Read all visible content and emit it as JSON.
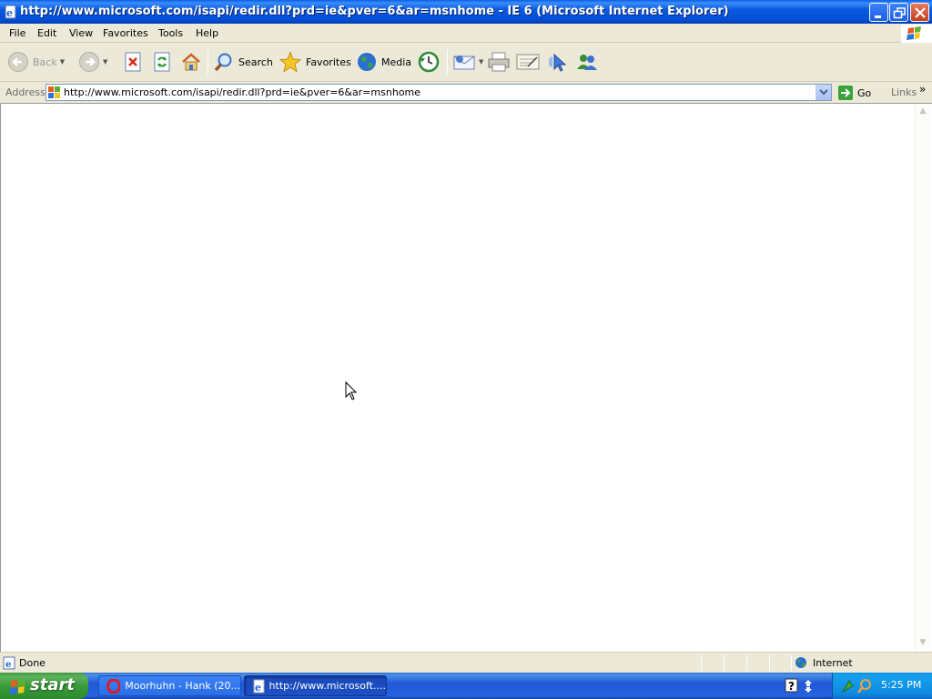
{
  "window": {
    "title": "http://www.microsoft.com/isapi/redir.dll?prd=ie&pver=6&ar=msnhome - IE 6 (Microsoft Internet Explorer)"
  },
  "menu": [
    "File",
    "Edit",
    "View",
    "Favorites",
    "Tools",
    "Help"
  ],
  "toolbar": {
    "back": "Back",
    "search": "Search",
    "favorites": "Favorites",
    "media": "Media"
  },
  "address": {
    "label": "Address",
    "url": "http://www.microsoft.com/isapi/redir.dll?prd=ie&pver=6&ar=msnhome",
    "go": "Go",
    "links": "Links"
  },
  "status": {
    "text": "Done",
    "zone": "Internet"
  },
  "taskbar": {
    "start": "start",
    "tasks": [
      "Moorhuhn - Hank (20...",
      "http://www.microsoft...."
    ],
    "clock": "5:25 PM"
  }
}
